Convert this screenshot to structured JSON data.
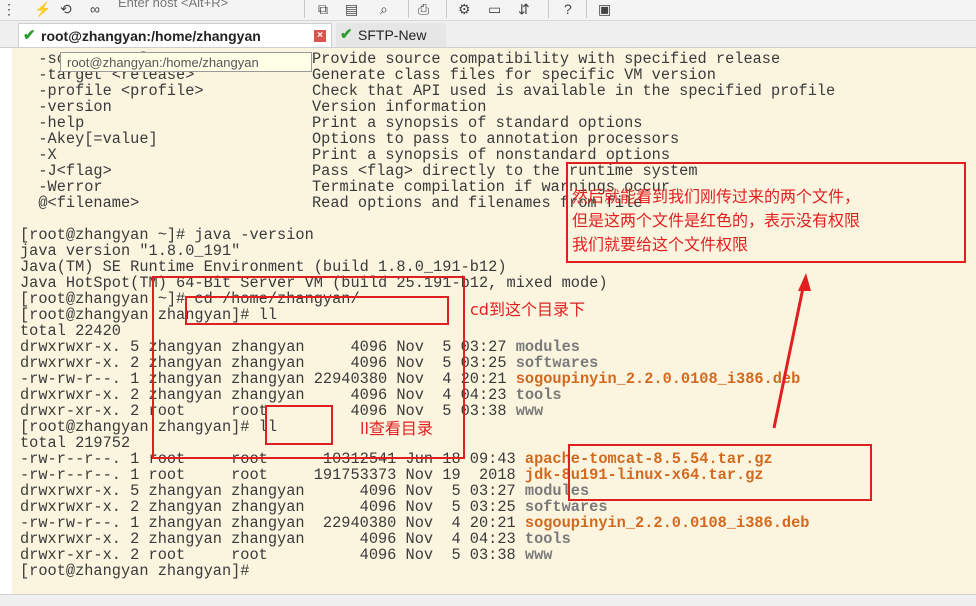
{
  "toolbar": {
    "host_placeholder": "Enter host <Alt+R>"
  },
  "tabs": [
    {
      "label": "root@zhangyan:/home/zhangyan",
      "active": true
    },
    {
      "label": "SFTP-New",
      "active": false
    }
  ],
  "tooltip": "root@zhangyan:/home/zhangyan",
  "terminal": {
    "help_lines": [
      {
        "opt": "  -source <release>",
        "desc": "Provide source compatibility with specified release"
      },
      {
        "opt": "  -target <release>",
        "desc": "Generate class files for specific VM version"
      },
      {
        "opt": "  -profile <profile>",
        "desc": "Check that API used is available in the specified profile"
      },
      {
        "opt": "  -version",
        "desc": "Version information"
      },
      {
        "opt": "  -help",
        "desc": "Print a synopsis of standard options"
      },
      {
        "opt": "  -Akey[=value]",
        "desc": "Options to pass to annotation processors"
      },
      {
        "opt": "  -X",
        "desc": "Print a synopsis of nonstandard options"
      },
      {
        "opt": "  -J<flag>",
        "desc": "Pass <flag> directly to the runtime system"
      },
      {
        "opt": "  -Werror",
        "desc": "Terminate compilation if warnings occur"
      },
      {
        "opt": "  @<filename>",
        "desc": "Read options and filenames from file"
      }
    ],
    "java_lines": [
      "[root@zhangyan ~]# java -version",
      "java version \"1.8.0_191\"",
      "Java(TM) SE Runtime Environment (build 1.8.0_191-b12)",
      "Java HotSpot(TM) 64-Bit Server VM (build 25.191-b12, mixed mode)",
      "[root@zhangyan ~]# cd /home/zhangyan/",
      "[root@zhangyan zhangyan]# ll",
      "total 22420"
    ],
    "listing1": [
      {
        "meta": "drwxrwxr-x. 5 zhangyan zhangyan     4096 Nov  5 03:27 ",
        "name": "modules",
        "kind": "dir"
      },
      {
        "meta": "drwxrwxr-x. 2 zhangyan zhangyan     4096 Nov  5 03:25 ",
        "name": "softwares",
        "kind": "dir"
      },
      {
        "meta": "-rw-rw-r--. 1 zhangyan zhangyan 22940380 Nov  4 20:21 ",
        "name": "sogoupinyin_2.2.0.0108_i386.deb",
        "kind": "file"
      },
      {
        "meta": "drwxrwxr-x. 2 zhangyan zhangyan     4096 Nov  4 04:23 ",
        "name": "tools",
        "kind": "dir"
      },
      {
        "meta": "drwxr-xr-x. 2 root     root         4096 Nov  5 03:38 ",
        "name": "www",
        "kind": "dir"
      }
    ],
    "ll_prompt": "[root@zhangyan zhangyan]# ll",
    "total2": "total 219752",
    "listing2": [
      {
        "meta": "-rw-r--r--. 1 root     root      10312541 Jun 18 09:43 ",
        "name": "apache-tomcat-8.5.54.tar.gz",
        "kind": "file"
      },
      {
        "meta": "-rw-r--r--. 1 root     root     191753373 Nov 19  2018 ",
        "name": "jdk-8u191-linux-x64.tar.gz",
        "kind": "file"
      },
      {
        "meta": "drwxrwxr-x. 5 zhangyan zhangyan      4096 Nov  5 03:27 ",
        "name": "modules",
        "kind": "dir"
      },
      {
        "meta": "drwxrwxr-x. 2 zhangyan zhangyan      4096 Nov  5 03:25 ",
        "name": "softwares",
        "kind": "dir"
      },
      {
        "meta": "-rw-rw-r--. 1 zhangyan zhangyan  22940380 Nov  4 20:21 ",
        "name": "sogoupinyin_2.2.0.0108_i386.deb",
        "kind": "file"
      },
      {
        "meta": "drwxrwxr-x. 2 zhangyan zhangyan      4096 Nov  4 04:23 ",
        "name": "tools",
        "kind": "dir"
      },
      {
        "meta": "drwxr-xr-x. 2 root     root          4096 Nov  5 03:38 ",
        "name": "www",
        "kind": "dir"
      }
    ],
    "final_prompt": "[root@zhangyan zhangyan]#"
  },
  "annotations": {
    "cd_note": "cd到这个目录下",
    "ll_note": "ll查看目录",
    "explain_lines": [
      "然后就能看到我们刚传过来的两个文件，",
      "但是这两个文件是红色的，表示没有权限",
      "我们就要给这个文件权限"
    ]
  },
  "colors": {
    "annotation_red": "#e02020",
    "terminal_bg": "#fbf5e0",
    "file_colored": "#d2691e"
  }
}
